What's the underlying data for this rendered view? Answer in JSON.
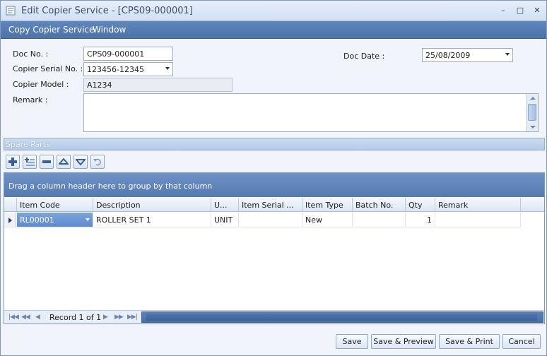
{
  "window": {
    "title": "Edit Copier Service - [CPS09-000001]",
    "min_glyph": "–",
    "max_glyph": "□",
    "close_glyph": "✕"
  },
  "menu": {
    "items": [
      "Copy Copier Service",
      "Window"
    ]
  },
  "form": {
    "doc_no_label": "Doc No. :",
    "doc_no_value": "CPS09-000001",
    "copier_serial_label": "Copier Serial No. :",
    "copier_serial_value": "123456-12345",
    "copier_model_label": "Copier Model :",
    "copier_model_value": "A1234",
    "remark_label": "Remark :",
    "remark_value": "",
    "doc_date_label": "Doc Date :",
    "doc_date_value": "25/08/2009"
  },
  "spare_parts": {
    "section_title": "Spare Parts",
    "toolbar_icons": [
      "add-row-icon",
      "insert-row-icon",
      "delete-row-icon",
      "move-up-icon",
      "move-down-icon",
      "undo-icon"
    ],
    "group_panel_text": "Drag a column header here to group by that column",
    "columns": [
      "Item Code",
      "Description",
      "U...",
      "Item Serial ...",
      "Item Type",
      "Batch No.",
      "Qty",
      "Remark"
    ],
    "rows": [
      {
        "item_code": "RL00001",
        "description": "ROLLER SET 1",
        "uom": "UNIT",
        "item_serial": "",
        "item_type": "New",
        "batch_no": "",
        "qty": "1",
        "remark": ""
      }
    ],
    "navigator_text": "Record 1 of 1"
  },
  "actions": {
    "save": "Save",
    "save_preview": "Save & Preview",
    "save_print": "Save & Print",
    "cancel": "Cancel"
  },
  "colors": {
    "accent": "#4c73aa",
    "selection": "#5f8ad0"
  }
}
